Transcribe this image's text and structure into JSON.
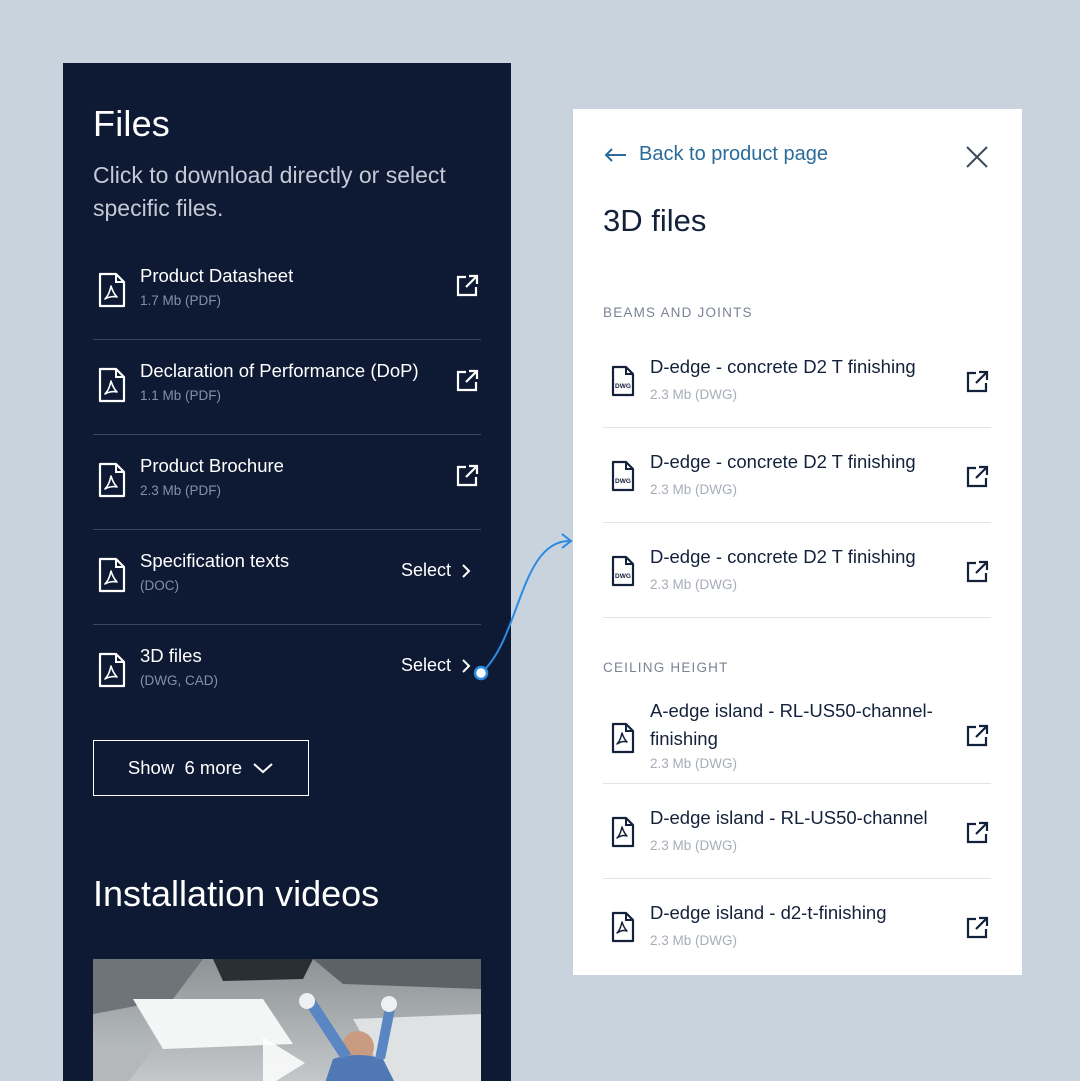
{
  "left": {
    "title": "Files",
    "subtitle": "Click to download directly or select specific files.",
    "files": [
      {
        "name": "Product Datasheet",
        "meta": "1.7 Mb (PDF)",
        "action": "external"
      },
      {
        "name": "Declaration of Performance (DoP)",
        "meta": "1.1 Mb (PDF)",
        "action": "external"
      },
      {
        "name": "Product Brochure",
        "meta": "2.3 Mb (PDF)",
        "action": "external"
      },
      {
        "name": "Specification texts",
        "meta": "(DOC)",
        "action": "select",
        "select_label": "Select"
      },
      {
        "name": "3D files",
        "meta": "(DWG, CAD)",
        "action": "select",
        "select_label": "Select"
      }
    ],
    "show_more_label": "Show  6 more",
    "videos_title": "Installation videos"
  },
  "right": {
    "back_label": "Back to product page",
    "title": "3D files",
    "sections": [
      {
        "label": "BEAMS AND JOINTS",
        "items": [
          {
            "name": "D-edge - concrete D2 T finishing",
            "meta": "2.3 Mb (DWG)",
            "icon": "dwg-file-icon",
            "icon_text": "DWG"
          },
          {
            "name": "D-edge - concrete D2 T finishing",
            "meta": "2.3 Mb (DWG)",
            "icon": "dwg-file-icon",
            "icon_text": "DWG"
          },
          {
            "name": "D-edge - concrete D2 T finishing",
            "meta": "2.3 Mb (DWG)",
            "icon": "dwg-file-icon",
            "icon_text": "DWG"
          }
        ]
      },
      {
        "label": "CEILING HEIGHT",
        "items": [
          {
            "name": "A-edge island - RL-US50-channel-finishing",
            "meta": "2.3 Mb (DWG)",
            "icon": "pdf-file-icon"
          },
          {
            "name": "D-edge island - RL-US50-channel",
            "meta": "2.3 Mb (DWG)",
            "icon": "pdf-file-icon"
          },
          {
            "name": "D-edge island - d2-t-finishing",
            "meta": "2.3 Mb (DWG)",
            "icon": "pdf-file-icon"
          }
        ]
      }
    ]
  },
  "colors": {
    "background": "#c9d3de",
    "dark_panel": "#0e1a33",
    "accent_link": "#2b6b9a",
    "connector": "#2a8be0"
  }
}
